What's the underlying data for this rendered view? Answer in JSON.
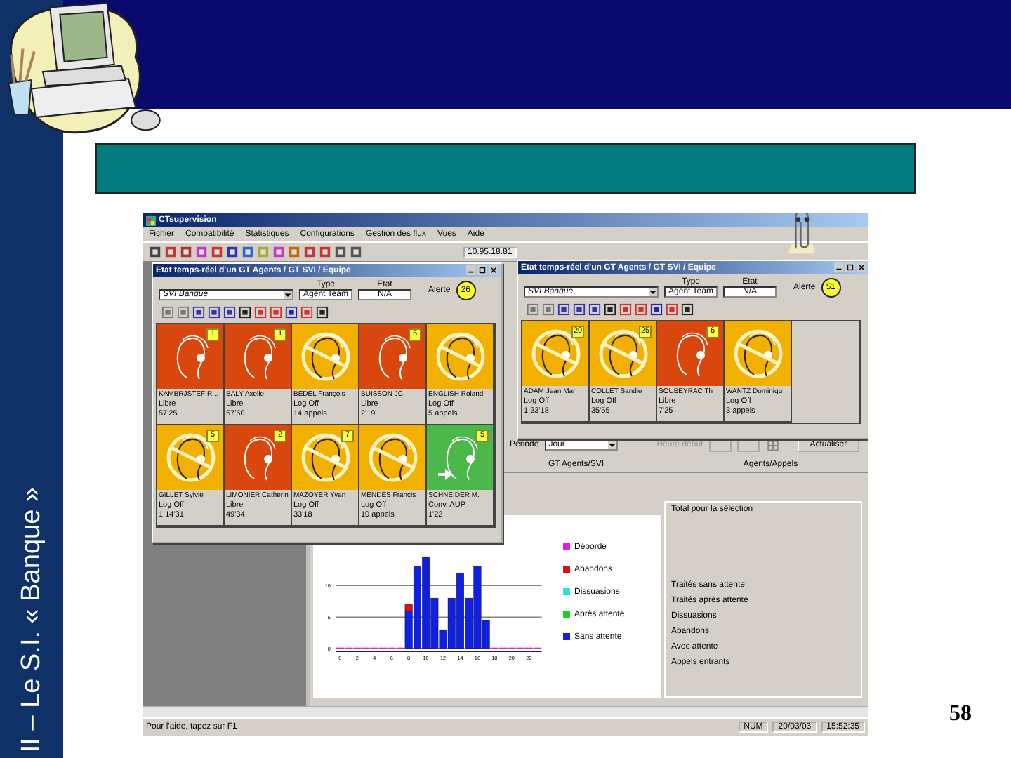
{
  "slide": {
    "side_title": "II – Le S.I. « Banque »",
    "page_number": "58"
  },
  "app": {
    "title": "CTsupervision",
    "menu": [
      "Fichier",
      "Compatibilité",
      "Statistiques",
      "Configurations",
      "Gestion des flux",
      "Vues",
      "Aide"
    ],
    "address": "10.95.18.81",
    "windows": [
      {
        "title": "Etat temps-réel d'un GT Agents / GT SVI / Equipe",
        "group": "SVI Banque",
        "type_label": "Type",
        "type_value": "Agent Team",
        "state_label": "Etat",
        "state_value": "N/A",
        "alert_label": "Alerte",
        "alert_value": "26",
        "agents": [
          {
            "name": "KAMBRJSTEF R...",
            "status": "Libre",
            "time": "57'25",
            "kind": "libre",
            "badge": "1"
          },
          {
            "name": "BALY Axelle",
            "status": "Libre",
            "time": "57'50",
            "kind": "libre",
            "badge": "1"
          },
          {
            "name": "BEDEL François",
            "status": "Log Off",
            "time": "14 appels",
            "kind": "logoff"
          },
          {
            "name": "BUISSON JC",
            "status": "Libre",
            "time": "2'19",
            "kind": "libre",
            "badge": "5"
          },
          {
            "name": "ENGLISH Roland",
            "status": "Log Off",
            "time": "5 appels",
            "kind": "logoff"
          },
          {
            "name": "GILLET Sylvie",
            "status": "Log Off",
            "time": "1:14'31",
            "kind": "logoff",
            "badge": "5"
          },
          {
            "name": "LIMONIER Catherin",
            "status": "Libre",
            "time": "49'34",
            "kind": "libre",
            "badge": "2"
          },
          {
            "name": "MAZOYER Yvan",
            "status": "Log Off",
            "time": "33'18",
            "kind": "logoff",
            "badge": "7"
          },
          {
            "name": "MENDES Francis",
            "status": "Log Off",
            "time": "10 appels",
            "kind": "logoff"
          },
          {
            "name": "SCHNEIDER M.",
            "status": "Conv. AUP",
            "time": "1'22",
            "kind": "conv",
            "badge": "5"
          }
        ]
      },
      {
        "title": "Etat temps-réel d'un GT Agents / GT SVI / Equipe",
        "group": "SVI Banque",
        "type_label": "Type",
        "type_value": "Agent Team",
        "state_label": "Etat",
        "state_value": "N/A",
        "alert_label": "Alerte",
        "alert_value": "51",
        "agents": [
          {
            "name": "ADAM Jean Mar",
            "status": "Log Off",
            "time": "1:33'18",
            "kind": "logoff",
            "badge": "20"
          },
          {
            "name": "COLLET Sandie",
            "status": "Log Off",
            "time": "35'55",
            "kind": "logoff",
            "badge": "25"
          },
          {
            "name": "SOUBEYRAC Th",
            "status": "Libre",
            "time": "7'25",
            "kind": "libre",
            "badge": "6"
          },
          {
            "name": "WANTZ Dominiqu",
            "status": "Log Off",
            "time": "3 appels",
            "kind": "logoff"
          }
        ]
      }
    ],
    "period_label": "Période",
    "period_value": "Jour",
    "start_label": "Heure début",
    "refresh_button": "Actualiser",
    "headers": [
      "GT Agents/SVI",
      "Agents/Appels"
    ],
    "chart_data": {
      "type": "bar",
      "stacked": true,
      "x": [
        0,
        1,
        2,
        3,
        4,
        5,
        6,
        7,
        8,
        9,
        10,
        11,
        12,
        13,
        14,
        15,
        16,
        17,
        18,
        19,
        20,
        21,
        22,
        23
      ],
      "xlim": [
        -0.5,
        23.5
      ],
      "xticks": [
        0,
        2,
        4,
        6,
        8,
        10,
        12,
        14,
        16,
        18,
        20,
        22
      ],
      "yticks": [
        0,
        5,
        10
      ],
      "ylim": [
        0,
        15
      ],
      "series": [
        {
          "name": "Débordé",
          "color": "#e020e0",
          "values": [
            0,
            0,
            0,
            0,
            0,
            0,
            0,
            0,
            0,
            0,
            0,
            0,
            0,
            0,
            0,
            0,
            0,
            0,
            0,
            0,
            0,
            0,
            0,
            0
          ]
        },
        {
          "name": "Abandons",
          "color": "#e01010",
          "values": [
            0,
            0,
            0,
            0,
            0,
            0,
            0,
            0,
            1,
            0,
            0,
            0,
            0,
            0,
            0,
            0,
            0,
            0,
            0,
            0,
            0,
            0,
            0,
            0
          ]
        },
        {
          "name": "Dissuasions",
          "color": "#30e0e0",
          "values": [
            0,
            0,
            0,
            0,
            0,
            0,
            0,
            0,
            0,
            0,
            0,
            0,
            0,
            0,
            0,
            0,
            0,
            0,
            0,
            0,
            0,
            0,
            0,
            0
          ]
        },
        {
          "name": "Après attente",
          "color": "#20d020",
          "values": [
            0,
            0,
            0,
            0,
            0,
            0,
            0,
            0,
            0,
            0,
            0,
            0,
            0,
            0,
            0,
            0,
            0,
            0,
            0,
            0,
            0,
            0,
            0,
            0
          ]
        },
        {
          "name": "Sans attente",
          "color": "#1020e0",
          "values": [
            0,
            0,
            0,
            0,
            0,
            0,
            0,
            0,
            6,
            13,
            14.5,
            8,
            3,
            8,
            12,
            8,
            13,
            4.5,
            0,
            0,
            0,
            0,
            0,
            0
          ]
        }
      ]
    },
    "total": {
      "title": "Total pour la sélection",
      "items": [
        "Traités sans attente",
        "Traités après attente",
        "Dissuasions",
        "Abandons",
        "Avec attente",
        "Appels entrants"
      ]
    },
    "status_bar": {
      "hint": "Pour l'aide, tapez sur F1",
      "num": "NUM",
      "date": "20/03/03",
      "time": "15:52:35"
    }
  }
}
